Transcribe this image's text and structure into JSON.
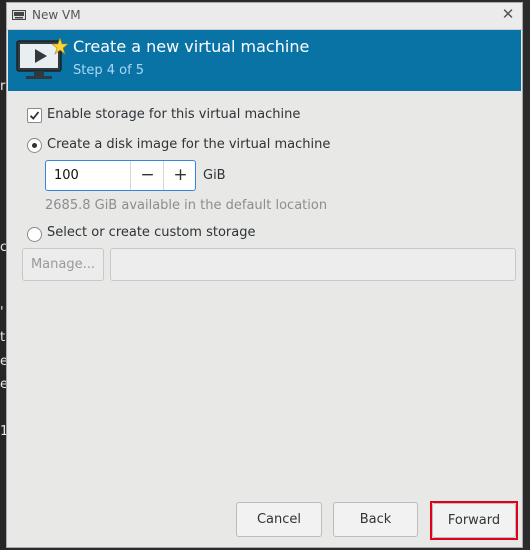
{
  "window": {
    "title": "New VM",
    "app_icon": "virt-manager-icon",
    "close_icon": "close-icon"
  },
  "header": {
    "title": "Create a new virtual machine",
    "step": "Step 4 of 5",
    "icon": "monitor-play-icon"
  },
  "storage": {
    "enable_label": "Enable storage for this virtual machine",
    "enable_checked": true,
    "create_disk_label": "Create a disk image for the virtual machine",
    "create_disk_selected": true,
    "size_value": "100",
    "size_unit": "GiB",
    "decrement_label": "−",
    "increment_label": "+",
    "available_text": "2685.8 GiB available in the default location",
    "custom_label": "Select or create custom storage",
    "custom_selected": false,
    "manage_label": "Manage...",
    "custom_path_value": ""
  },
  "footer": {
    "cancel_label": "Cancel",
    "back_label": "Back",
    "forward_label": "Forward",
    "highlight_color": "#e3001b"
  },
  "background": {
    "glyphs": [
      "r",
      "c",
      "'",
      "t",
      "e",
      "e",
      "1"
    ]
  }
}
